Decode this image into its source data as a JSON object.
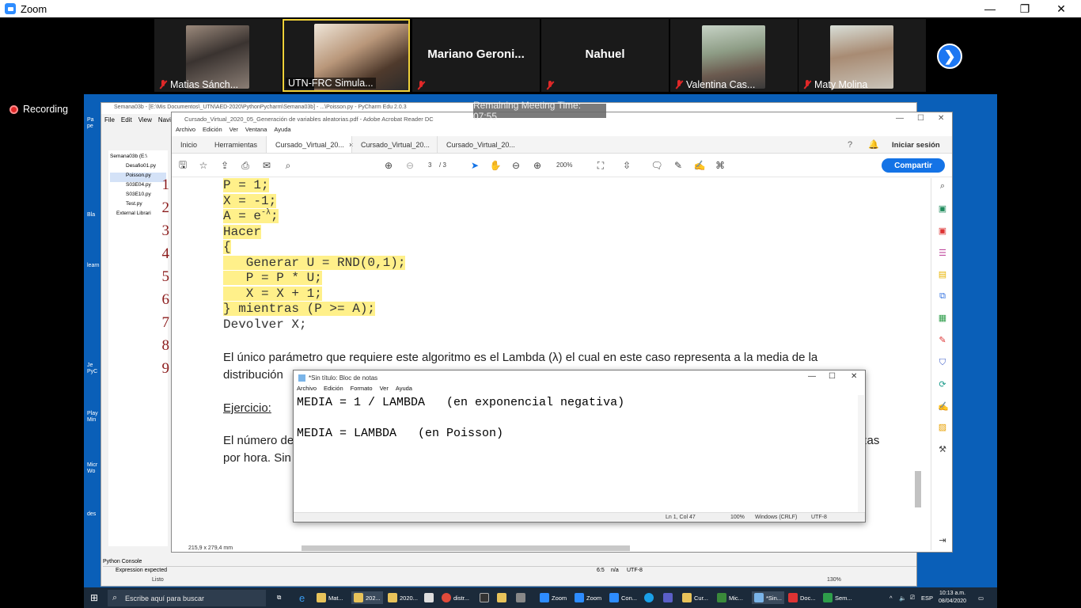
{
  "zoom": {
    "title": "Zoom",
    "recording": "Recording",
    "remaining_time": "Remaining Meeting Time: 07:55",
    "participants": [
      {
        "name": "Matias Sánch...",
        "has_video": true
      },
      {
        "name": "UTN-FRC Simula...",
        "has_video": true
      },
      {
        "name": "Mariano  Geroni...",
        "has_video": false
      },
      {
        "name": "Nahuel",
        "has_video": false
      },
      {
        "name": "Valentina Cas...",
        "has_video": true
      },
      {
        "name": "Maty Molina",
        "has_video": true
      }
    ]
  },
  "pycharm": {
    "title": "Semana03b - [E:\\Mis Documentos\\_UTN\\AED-2020\\PythonPycharm\\Semana03b] - ...\\Poisson.py - PyCharm Edu 2.0.3",
    "menu": [
      "File",
      "Edit",
      "View",
      "Navigat"
    ],
    "tree": [
      "Semana03b (E:\\",
      "Desafio01.py",
      "Poisson.py",
      "S03E04.py",
      "S03E10.py",
      "Test.py",
      "External Librari"
    ],
    "console": "Python Console",
    "status_left": "Expression expected",
    "status_pos": "6:5",
    "status_na": "n/a",
    "status_enc": "UTF-8",
    "listo": "Listo",
    "zoom_pct": "130%"
  },
  "acrobat": {
    "title": "Cursado_Virtual_2020_05_Generación de variables aleatorias.pdf - Adobe Acrobat Reader DC",
    "menu": [
      "Archivo",
      "Edición",
      "Ver",
      "Ventana",
      "Ayuda"
    ],
    "tabs": {
      "inicio": "Inicio",
      "herramientas": "Herramientas",
      "doc1": "Cursado_Virtual_20...",
      "doc2": "Cursado_Virtual_20...",
      "doc3": "Cursado_Virtual_20..."
    },
    "signin": "Iniciar sesión",
    "page_current": "3",
    "page_total": "/ 3",
    "zoom": "200%",
    "share": "Compartir",
    "page_size": "215,9 x 279,4 mm",
    "code_lines": [
      {
        "num": "1",
        "text": "P = 1;"
      },
      {
        "num": "2",
        "text": "X = -1;"
      },
      {
        "num": "3",
        "text": "A = e"
      },
      {
        "num": "4",
        "text": "Hacer"
      },
      {
        "num": "5",
        "text": "{"
      },
      {
        "num": "6",
        "text": "   Generar U = RND(0,1);"
      },
      {
        "num": "7",
        "text": "   P = P * U;"
      },
      {
        "num": "8",
        "text": "   X = X + 1;"
      },
      {
        "num": "9",
        "text": "} mientras (P >= A);"
      }
    ],
    "line10": "Devolver X;",
    "exp": "-λ",
    "para1": "El único parámetro que requiere este algoritmo es el Lambda (λ) el cual en este caso representa a la media de la",
    "para1b": "distribución",
    "ejercicio": "Ejercicio:",
    "para2a": "El número de",
    "para2b": "zas",
    "para3": "por hora. Sin"
  },
  "notepad": {
    "title": "*Sin título: Bloc de notas",
    "menu": [
      "Archivo",
      "Edición",
      "Formato",
      "Ver",
      "Ayuda"
    ],
    "line1": "MEDIA = 1 / LAMBDA   (en exponencial negativa)",
    "line2": "",
    "line3": "MEDIA = LAMBDA   (en Poisson)",
    "status": {
      "pos": "Ln 1, Col 47",
      "zoom": "100%",
      "eol": "Windows (CRLF)",
      "enc": "UTF-8"
    }
  },
  "taskbar": {
    "search": "Escribe aquí para buscar",
    "apps": [
      "Mat...",
      "202...",
      "2020...",
      "distr...",
      "Zoom",
      "Zoom",
      "Con...",
      "Cur...",
      "Mic...",
      "*Sin...",
      "Doc...",
      "Sem..."
    ],
    "lang": "ESP",
    "time": "10:13 a.m.",
    "date": "08/04/2020"
  }
}
